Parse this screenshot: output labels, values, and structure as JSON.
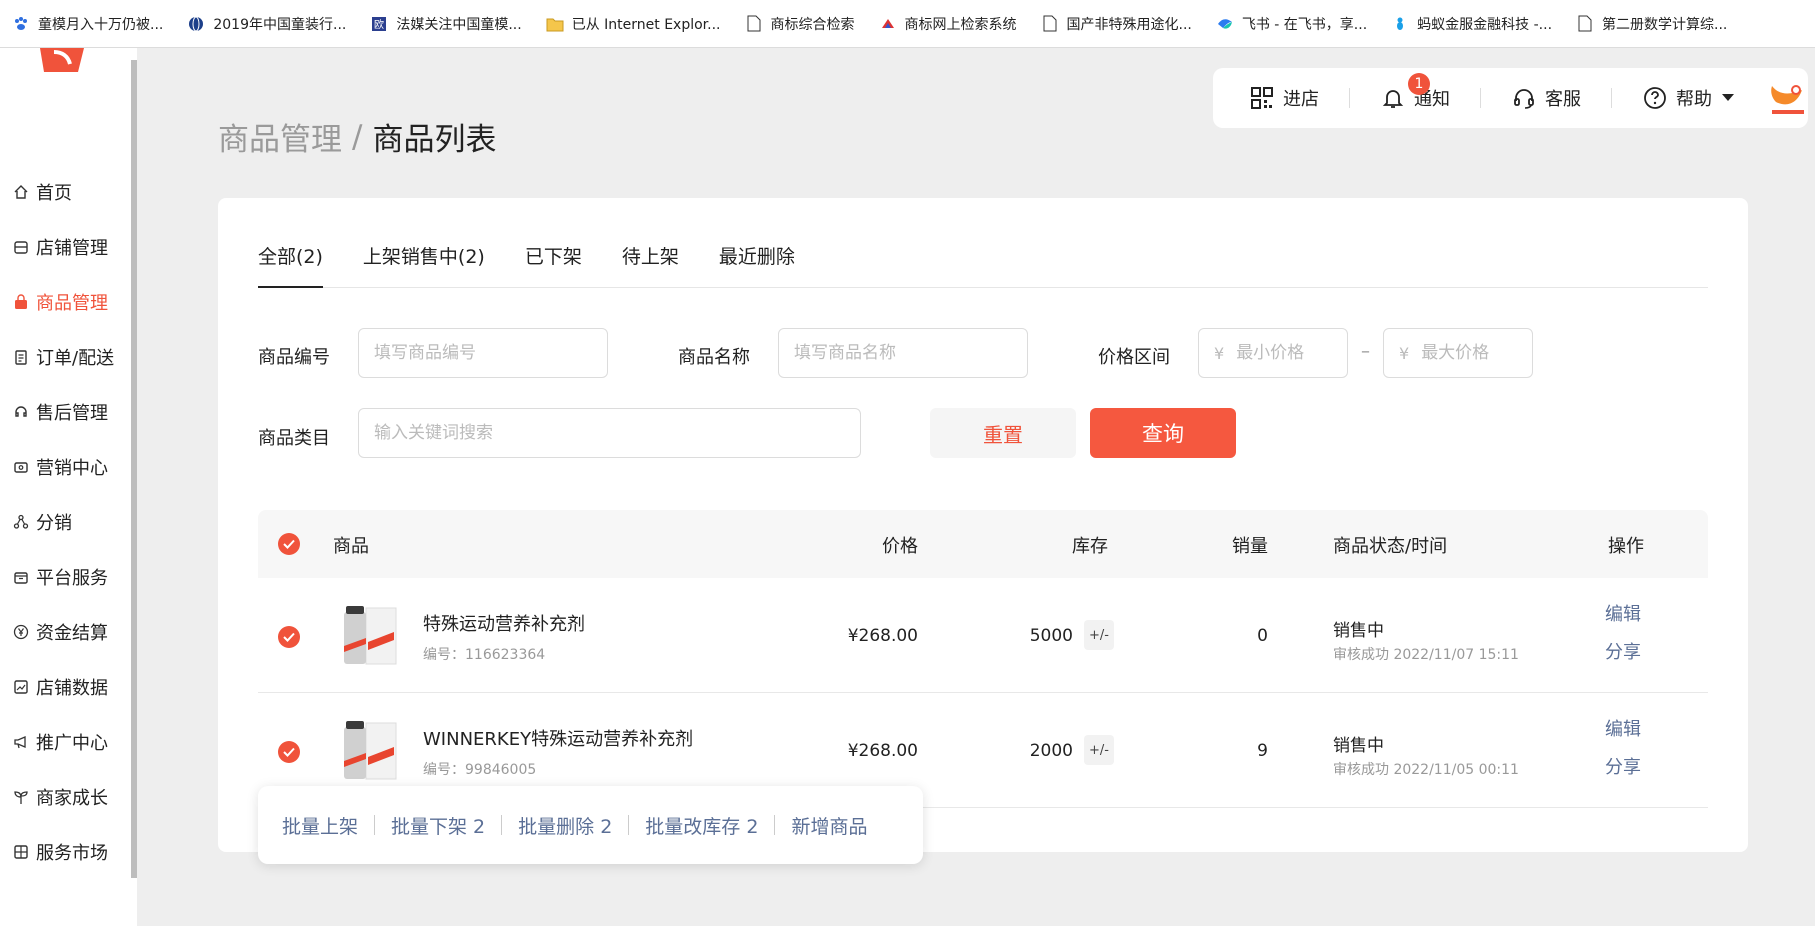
{
  "bookmarks": [
    {
      "label": "童模月入十万仍被...",
      "icon": "paw-icon"
    },
    {
      "label": "2019年中国童装行...",
      "icon": "globe-icon"
    },
    {
      "label": "法媒关注中国童模...",
      "icon": "site-icon"
    },
    {
      "label": "已从 Internet Explor...",
      "icon": "folder-icon"
    },
    {
      "label": "商标综合检索",
      "icon": "page-icon"
    },
    {
      "label": "商标网上检索系统",
      "icon": "site-icon"
    },
    {
      "label": "国产非特殊用途化...",
      "icon": "page-icon"
    },
    {
      "label": "飞书 - 在飞书，享...",
      "icon": "feishu-icon"
    },
    {
      "label": "蚂蚁金服金融科技 -...",
      "icon": "ant-icon"
    },
    {
      "label": "第二册数学计算综...",
      "icon": "page-icon"
    }
  ],
  "sidebar": {
    "items": [
      {
        "label": "首页",
        "icon": "home-icon"
      },
      {
        "label": "店铺管理",
        "icon": "shop-icon"
      },
      {
        "label": "商品管理",
        "icon": "bag-icon",
        "active": true
      },
      {
        "label": "订单/配送",
        "icon": "order-icon"
      },
      {
        "label": "售后管理",
        "icon": "headset-icon"
      },
      {
        "label": "营销中心",
        "icon": "ticket-icon"
      },
      {
        "label": "分销",
        "icon": "share-nodes-icon"
      },
      {
        "label": "平台服务",
        "icon": "box-icon"
      },
      {
        "label": "资金结算",
        "icon": "yen-icon"
      },
      {
        "label": "店铺数据",
        "icon": "chart-icon"
      },
      {
        "label": "推广中心",
        "icon": "megaphone-icon"
      },
      {
        "label": "商家成长",
        "icon": "sprout-icon"
      },
      {
        "label": "服务市场",
        "icon": "grid-icon"
      }
    ]
  },
  "toolbar": {
    "shop": "进店",
    "notify": "通知",
    "notify_count": "1",
    "service": "客服",
    "help": "帮助"
  },
  "breadcrumb": {
    "parent": "商品管理",
    "separator": "/",
    "current": "商品列表"
  },
  "tabs": [
    {
      "label": "全部(2)",
      "active": true
    },
    {
      "label": "上架销售中(2)"
    },
    {
      "label": "已下架"
    },
    {
      "label": "待上架"
    },
    {
      "label": "最近删除"
    }
  ],
  "filters": {
    "code_label": "商品编号",
    "code_placeholder": "填写商品编号",
    "name_label": "商品名称",
    "name_placeholder": "填写商品名称",
    "price_label": "价格区间",
    "currency": "¥",
    "min_placeholder": "最小价格",
    "max_placeholder": "最大价格",
    "range_dash": "–",
    "category_label": "商品类目",
    "category_placeholder": "输入关键词搜索",
    "reset": "重置",
    "query": "查询"
  },
  "table": {
    "headers": {
      "product": "商品",
      "price": "价格",
      "stock": "库存",
      "sales": "销量",
      "status": "商品状态/时间",
      "ops": "操作"
    },
    "rows": [
      {
        "name": "特殊运动营养补充剂",
        "code": "编号：116623364",
        "price": "¥268.00",
        "stock": "5000",
        "stock_adjust": "+/-",
        "sales": "0",
        "status": "销售中",
        "status_sub": "审核成功 2022/11/07 15:11",
        "edit": "编辑",
        "share": "分享"
      },
      {
        "name": "WINNERKEY特殊运动营养补充剂",
        "code": "编号：99846005",
        "price": "¥268.00",
        "stock": "2000",
        "stock_adjust": "+/-",
        "sales": "9",
        "status": "销售中",
        "status_sub": "审核成功 2022/11/05 00:11",
        "edit": "编辑",
        "share": "分享"
      }
    ]
  },
  "batch": {
    "on_shelf": "批量上架",
    "off_shelf": "批量下架 2",
    "delete": "批量删除 2",
    "stock": "批量改库存 2",
    "add": "新增商品"
  },
  "colors": {
    "accent": "#f0533b",
    "link": "#5b6f96"
  }
}
